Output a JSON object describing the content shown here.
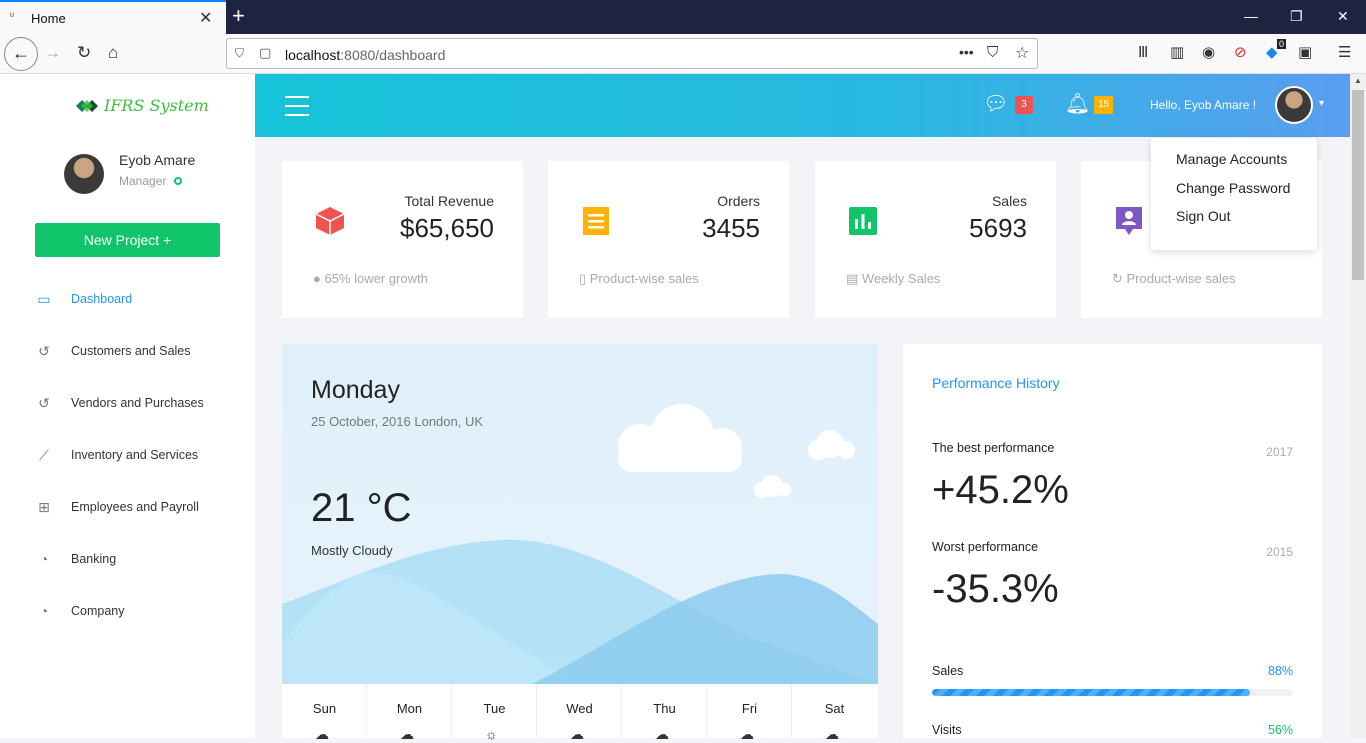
{
  "browser": {
    "tab_title": "Home",
    "tab_close": "✕",
    "new_tab": "+",
    "url_host": "localhost",
    "url_path": ":8080/dashboard",
    "ext_badge": "0"
  },
  "sidebar": {
    "logo_text": "IFRS System",
    "user_name": "Eyob Amare",
    "user_role": "Manager",
    "new_project_label": "New Project +",
    "items": [
      {
        "label": "Dashboard",
        "icon": "monitor-icon",
        "active": true
      },
      {
        "label": "Customers and Sales",
        "icon": "history-icon"
      },
      {
        "label": "Vendors and Purchases",
        "icon": "history-icon"
      },
      {
        "label": "Inventory and Services",
        "icon": "line-chart-icon"
      },
      {
        "label": "Employees and Payroll",
        "icon": "table-icon"
      },
      {
        "label": "Banking",
        "icon": "pie-icon"
      },
      {
        "label": "Company",
        "icon": "pie-icon"
      }
    ]
  },
  "topbar": {
    "messages_count": "3",
    "notifications_count": "15",
    "greeting": "Hello, Eyob Amare !"
  },
  "dropdown": {
    "items": [
      "Manage Accounts",
      "Change Password",
      "Sign Out"
    ]
  },
  "cards": [
    {
      "label": "Total Revenue",
      "value": "$65,650",
      "footer": "65% lower growth",
      "color": "#ef5350"
    },
    {
      "label": "Orders",
      "value": "3455",
      "footer": "Product-wise sales",
      "color": "#ffb300"
    },
    {
      "label": "Sales",
      "value": "5693",
      "footer": "Weekly Sales",
      "color": "#10c469"
    },
    {
      "label": "",
      "value": "",
      "footer": "Product-wise sales",
      "color": "#7e57c2"
    }
  ],
  "weather": {
    "day": "Monday",
    "date": "25 October, 2016 London, UK",
    "temp": "21 °C",
    "desc": "Mostly Cloudy",
    "week": [
      "Sun",
      "Mon",
      "Tue",
      "Wed",
      "Thu",
      "Fri",
      "Sat"
    ]
  },
  "performance": {
    "title": "Performance History",
    "best_label": "The best performance",
    "best_year": "2017",
    "best_value": "+45.2%",
    "worst_label": "Worst performance",
    "worst_year": "2015",
    "worst_value": "-35.3%",
    "sales_label": "Sales",
    "sales_pct": "88%",
    "sales_fraction": 0.88,
    "visits_label": "Visits",
    "visits_pct": "56%",
    "accent": "#2196f3",
    "visits_color": "#10c469"
  }
}
